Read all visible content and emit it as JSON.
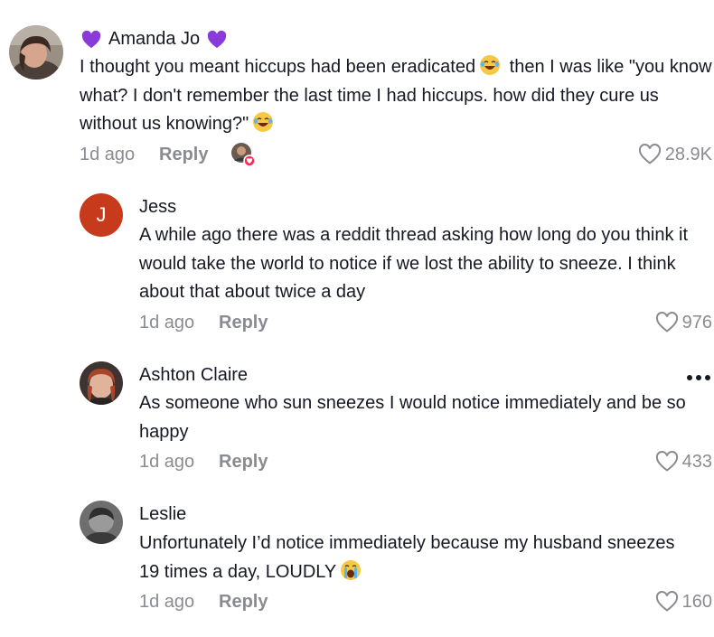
{
  "comments": [
    {
      "author": "Amanda Jo",
      "text_parts": [
        "I thought you meant hiccups had been eradicated",
        " then I was like \"you know what? I don't remember the last time I had hiccups. how did they cure us without us knowing?\""
      ],
      "time": "1d ago",
      "reply_label": "Reply",
      "likes": "28.9K",
      "author_decoration_icon": "purple-heart-emoji",
      "emoji": "laughing-tears-emoji"
    },
    {
      "author": "Jess",
      "avatar_letter": "J",
      "text": "A while ago there was a reddit thread asking how long do you think it would take the world to notice if we lost the ability to sneeze. I think about that about twice a day",
      "time": "1d ago",
      "reply_label": "Reply",
      "likes": "976"
    },
    {
      "author": "Ashton Claire",
      "text": "As someone who sun sneezes I would notice immediately and be so happy",
      "time": "1d ago",
      "reply_label": "Reply",
      "likes": "433"
    },
    {
      "author": "Leslie",
      "text_parts": [
        "Unfortunately I’d notice immediately because my husband sneezes 19 times a day, LOUDLY"
      ],
      "time": "1d ago",
      "reply_label": "Reply",
      "likes": "160",
      "emoji": "crying-face-emoji"
    }
  ],
  "colors": {
    "text": "#161823",
    "muted": "#8a8b91",
    "avatar_j": "#c83a1c",
    "heart_purple": "#8a3ad9"
  }
}
